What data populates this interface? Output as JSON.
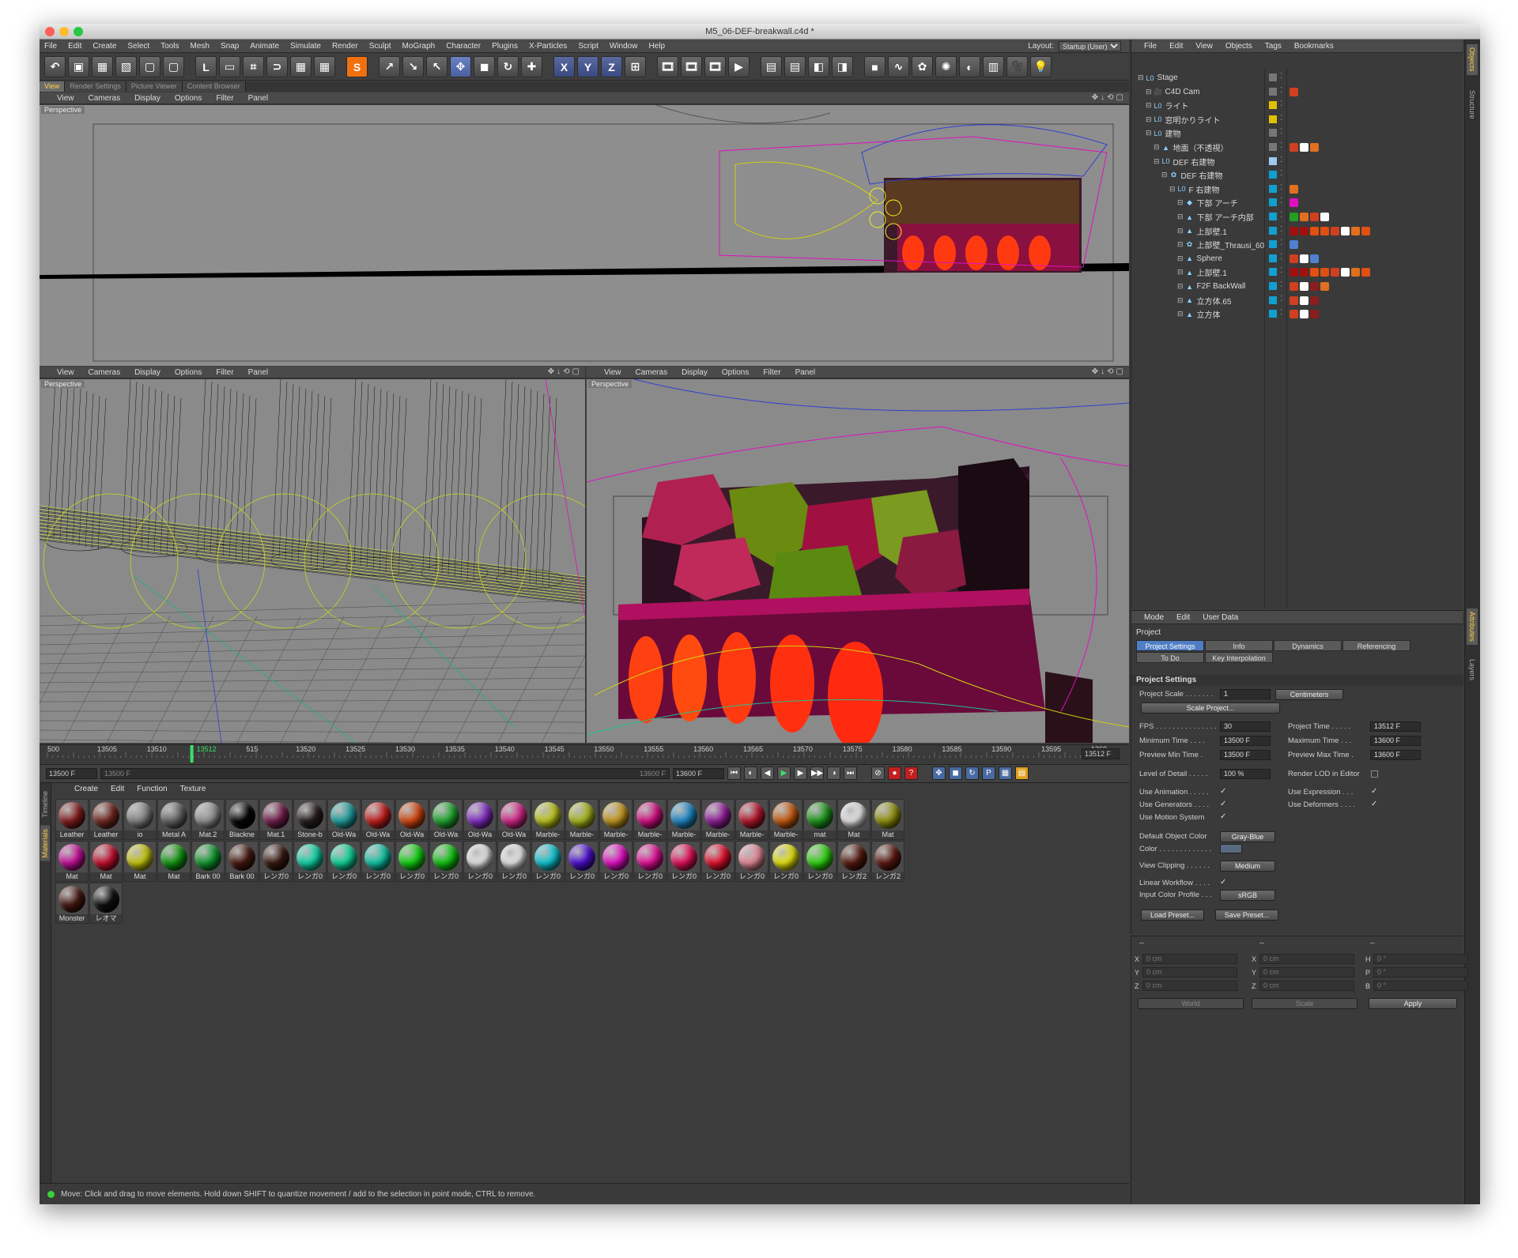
{
  "window": {
    "title": "M5_06-DEF-breakwall.c4d *",
    "traffic_colors": [
      "#ff5f57",
      "#febc2e",
      "#28c840"
    ]
  },
  "menubar": {
    "items": [
      "File",
      "Edit",
      "Create",
      "Select",
      "Tools",
      "Mesh",
      "Snap",
      "Animate",
      "Simulate",
      "Render",
      "Sculpt",
      "MoGraph",
      "Character",
      "Plugins",
      "X-Particles",
      "Script",
      "Window",
      "Help"
    ],
    "layout_label": "Layout:",
    "layout_value": "Startup (User)"
  },
  "toolbar": {
    "icons": [
      "undo-icon",
      "cube-view-icon",
      "checker-icon",
      "grid-icon",
      "box-icon",
      "box-icon",
      "axis-icon",
      "frame-icon",
      "crop-icon",
      "magnet-icon",
      "grid-snap-icon",
      "grid-snap-icon",
      "sculpt-s-icon",
      "arrow-icon",
      "arrow-icon",
      "select-icon",
      "move-icon",
      "scale-icon",
      "rotate-icon",
      "plus-icon",
      "x-axis-icon",
      "y-axis-icon",
      "z-axis-icon",
      "coords-icon",
      "film-icon",
      "film-icon",
      "film-icon",
      "play-icon",
      "render-icon",
      "render-icon",
      "render-icon",
      "render-icon",
      "cube-icon",
      "spline-icon",
      "nurbs-icon",
      "array-icon",
      "deformer-icon",
      "floor-icon",
      "camera-icon",
      "light-icon"
    ],
    "glyphs": [
      "↶",
      "▣",
      "▦",
      "▧",
      "▢",
      "▢",
      "L",
      "▭",
      "⌗",
      "⊃",
      "▦",
      "▦",
      "S",
      "↗",
      "↘",
      "↖",
      "✥",
      "◼",
      "↻",
      "✚",
      "X",
      "Y",
      "Z",
      "⊞",
      "🎞",
      "🎞",
      "🎞",
      "▶",
      "▤",
      "▤",
      "◧",
      "◨",
      "■",
      "∿",
      "✿",
      "✺",
      "◐",
      "▥",
      "🎥",
      "💡"
    ]
  },
  "tabs": [
    "View",
    "Render Settings",
    "Picture Viewer",
    "Content Browser"
  ],
  "viewport_menu": [
    "View",
    "Cameras",
    "Display",
    "Options",
    "Filter",
    "Panel"
  ],
  "viewport_label": "Perspective",
  "timeline": {
    "ticks": [
      "500",
      "13505",
      "13510",
      "13512",
      "515",
      "13520",
      "13525",
      "13530",
      "13535",
      "13540",
      "13545",
      "13550",
      "13555",
      "13560",
      "13565",
      "13570",
      "13575",
      "13580",
      "13585",
      "13590",
      "13595",
      "1360"
    ],
    "current_frame": "13512 F",
    "range_start": "13500 F",
    "range_field": "13500 F",
    "range_end_field": "13600 F",
    "end_frame": "13600 F"
  },
  "transport_glyphs": [
    "⏮",
    "◐",
    "◀",
    "▶",
    "▶",
    "▶▶",
    "◑",
    "⏭",
    "⊘",
    "●",
    "?",
    "✥",
    "◼",
    "↻",
    "P",
    "▦",
    "▤"
  ],
  "materials": {
    "menu": [
      "Create",
      "Edit",
      "Function",
      "Texture"
    ],
    "tabs": [
      "Timeline",
      "Materials"
    ],
    "items": [
      {
        "name": "Leather",
        "color": "#8a1e1e"
      },
      {
        "name": "Leather",
        "color": "#7a2a22"
      },
      {
        "name": "io",
        "color": "#8a8a8a"
      },
      {
        "name": "Metal A",
        "color": "#6a6a6a"
      },
      {
        "name": "Mat.2",
        "color": "#9a9a9a"
      },
      {
        "name": "Blackne",
        "color": "#050505"
      },
      {
        "name": "Mat.1",
        "color": "#7a2050"
      },
      {
        "name": "Stone-b",
        "color": "#2a2020"
      },
      {
        "name": "Old-Wa",
        "color": "#20a8a8"
      },
      {
        "name": "Old-Wa",
        "color": "#d02020"
      },
      {
        "name": "Old-Wa",
        "color": "#e04a10"
      },
      {
        "name": "Old-Wa",
        "color": "#20b030"
      },
      {
        "name": "Old-Wa",
        "color": "#8a30d0"
      },
      {
        "name": "Old-Wa",
        "color": "#e02a90"
      },
      {
        "name": "Marble-",
        "color": "#c8d020"
      },
      {
        "name": "Marble-",
        "color": "#b0c020"
      },
      {
        "name": "Marble-",
        "color": "#d0a020"
      },
      {
        "name": "Marble-",
        "color": "#e0108a"
      },
      {
        "name": "Marble-",
        "color": "#2090d0"
      },
      {
        "name": "Marble-",
        "color": "#9a20a0"
      },
      {
        "name": "Marble-",
        "color": "#c01830"
      },
      {
        "name": "Marble-",
        "color": "#d06010"
      },
      {
        "name": "mat",
        "color": "#1ea01e"
      },
      {
        "name": "Mat",
        "color": "#f0f0f0"
      },
      {
        "name": "Mat",
        "color": "#9a9a10"
      },
      {
        "name": "Mat",
        "color": "#d010a0"
      },
      {
        "name": "Mat",
        "color": "#d01030"
      },
      {
        "name": "Mat",
        "color": "#d0d010"
      },
      {
        "name": "Mat",
        "color": "#10a010"
      },
      {
        "name": "Bark 00",
        "color": "#10a030"
      },
      {
        "name": "Bark 00",
        "color": "#4a1a10"
      },
      {
        "name": "レンガ0",
        "color": "#3a1a10"
      },
      {
        "name": "レンガ0",
        "color": "#10e0b0"
      },
      {
        "name": "レンガ0",
        "color": "#10e0a0"
      },
      {
        "name": "レンガ0",
        "color": "#10d0b0"
      },
      {
        "name": "レンガ0",
        "color": "#10e010"
      },
      {
        "name": "レンガ0",
        "color": "#10d010"
      },
      {
        "name": "レンガ0",
        "color": "#f0f0f0"
      },
      {
        "name": "レンガ0",
        "color": "#f4f4f4"
      },
      {
        "name": "レンガ0",
        "color": "#10d0e0"
      },
      {
        "name": "レンガ0",
        "color": "#5010e0"
      },
      {
        "name": "レンガ0",
        "color": "#f010d0"
      },
      {
        "name": "レンガ0",
        "color": "#f010a0"
      },
      {
        "name": "レンガ0",
        "color": "#f01060"
      },
      {
        "name": "レンガ0",
        "color": "#f01030"
      },
      {
        "name": "レンガ0",
        "color": "#f090a0"
      },
      {
        "name": "レンガ0",
        "color": "#f0f010"
      },
      {
        "name": "レンガ0",
        "color": "#30e010"
      },
      {
        "name": "レンガ2",
        "color": "#5a1a10"
      },
      {
        "name": "レンガ2",
        "color": "#601a12"
      },
      {
        "name": "Monster",
        "color": "#4a1a14"
      },
      {
        "name": "レオマ",
        "color": "#101010"
      }
    ]
  },
  "status": {
    "text": "Move: Click and drag to move elements. Hold down SHIFT to quantize movement / add to the selection in point mode, CTRL to remove."
  },
  "objects": {
    "menu": [
      "File",
      "Edit",
      "View",
      "Objects",
      "Tags",
      "Bookmarks"
    ],
    "rows": [
      {
        "name": "Stage",
        "indent": 0,
        "icon": "layer-null-icon",
        "glyph": "L0",
        "layer": "#777777",
        "tags": []
      },
      {
        "name": "C4D Cam",
        "indent": 1,
        "icon": "camera-icon",
        "glyph": "🎥",
        "layer": "#777777",
        "tags": [
          "#d04020"
        ]
      },
      {
        "name": "ライト",
        "indent": 1,
        "icon": "layer-null-icon",
        "glyph": "L0",
        "layer": "#e0c000",
        "tags": []
      },
      {
        "name": "窓明かりライト",
        "indent": 1,
        "icon": "layer-null-icon",
        "glyph": "L0",
        "layer": "#e0c000",
        "tags": []
      },
      {
        "name": "建物",
        "indent": 1,
        "icon": "layer-null-icon",
        "glyph": "L0",
        "layer": "#777777",
        "tags": []
      },
      {
        "name": "地面（不透視）",
        "indent": 2,
        "icon": "polygon-icon",
        "glyph": "▲",
        "layer": "#777777",
        "tags": [
          "#d04020",
          "#ffffff",
          "#e07020"
        ]
      },
      {
        "name": "DEF 右建物",
        "indent": 2,
        "icon": "layer-null-icon",
        "glyph": "L0",
        "layer": "#a0c8f0",
        "tags": []
      },
      {
        "name": "DEF 右建物",
        "indent": 3,
        "icon": "fracture-icon",
        "glyph": "✿",
        "layer": "#10a0d0",
        "tags": []
      },
      {
        "name": "F 右建物",
        "indent": 4,
        "icon": "layer-null-icon",
        "glyph": "L0",
        "layer": "#10a0d0",
        "tags": [
          "#e07020"
        ]
      },
      {
        "name": "下部 アーチ",
        "indent": 5,
        "icon": "deformer-icon",
        "glyph": "◆",
        "layer": "#10a0d0",
        "tags": [
          "#e010c0"
        ]
      },
      {
        "name": "下部 アーチ内部",
        "indent": 5,
        "icon": "polygon-icon",
        "glyph": "▲",
        "layer": "#10a0d0",
        "tags": [
          "#20a020",
          "#e07020",
          "#d04020",
          "#ffffff"
        ]
      },
      {
        "name": "上部壁.1",
        "indent": 5,
        "icon": "polygon-icon",
        "glyph": "▲",
        "layer": "#10a0d0",
        "tags": [
          "#a01010",
          "#a01010",
          "#e05010",
          "#e05010",
          "#d04020",
          "#ffffff",
          "#e07020",
          "#e05010"
        ]
      },
      {
        "name": "上部壁_Thrausi_60",
        "indent": 5,
        "icon": "fracture-icon",
        "glyph": "✿",
        "layer": "#10a0d0",
        "tags": [
          "#5080d0"
        ]
      },
      {
        "name": "Sphere",
        "indent": 5,
        "icon": "polygon-icon",
        "glyph": "▲",
        "layer": "#10a0d0",
        "tags": [
          "#d04020",
          "#ffffff",
          "#5080d0"
        ]
      },
      {
        "name": "上部壁.1",
        "indent": 5,
        "icon": "polygon-icon",
        "glyph": "▲",
        "layer": "#10a0d0",
        "tags": [
          "#a01010",
          "#a01010",
          "#e05010",
          "#e05010",
          "#d04020",
          "#ffffff",
          "#e07020",
          "#e05010"
        ]
      },
      {
        "name": "F2F BackWall",
        "indent": 5,
        "icon": "polygon-icon",
        "glyph": "▲",
        "layer": "#10a0d0",
        "tags": [
          "#d04020",
          "#ffffff",
          "#8a1e1e",
          "#e07020"
        ]
      },
      {
        "name": "立方体.65",
        "indent": 5,
        "icon": "polygon-icon",
        "glyph": "▲",
        "layer": "#10a0d0",
        "tags": [
          "#d04020",
          "#ffffff",
          "#8a1e1e"
        ]
      },
      {
        "name": "立方体",
        "indent": 5,
        "icon": "polygon-icon",
        "glyph": "▲",
        "layer": "#10a0d0",
        "tags": [
          "#d04020",
          "#ffffff",
          "#8a1e1e"
        ]
      }
    ]
  },
  "attributes": {
    "menu": [
      "Mode",
      "Edit",
      "User Data"
    ],
    "header": "Project",
    "tabs": [
      "Project Settings",
      "Info",
      "Dynamics",
      "Referencing",
      "To Do",
      "Key Interpolation"
    ],
    "section": "Project Settings",
    "project_scale_label": "Project Scale . . . . . . .",
    "project_scale_value": "1",
    "project_scale_unit": "Centimeters",
    "scale_project_button": "Scale Project...",
    "fps_label": "FPS . . . . . . . . . . . . . . .",
    "fps_value": "30",
    "project_time_label": "Project Time . . . . .",
    "project_time_value": "13512 F",
    "min_time_label": "Minimum Time . . . .",
    "min_time_value": "13500 F",
    "max_time_label": "Maximum Time . . .",
    "max_time_value": "13600 F",
    "preview_min_label": "Preview Min Time .",
    "preview_min_value": "13500 F",
    "preview_max_label": "Preview Max Time .",
    "preview_max_value": "13600 F",
    "lod_label": "Level of Detail . . . . .",
    "lod_value": "100 %",
    "render_lod_label": "Render LOD in Editor",
    "use_animation_label": "Use Animation . . . . .",
    "use_expression_label": "Use Expression . . .",
    "use_generators_label": "Use Generators . . . .",
    "use_deformers_label": "Use Deformers . . . .",
    "use_motion_label": "Use Motion System",
    "default_color_label": "Default Object Color",
    "default_color_value": "Gray-Blue",
    "color_label": "Color . . . . . . . . . . . . .",
    "view_clipping_label": "View Clipping . . . . . .",
    "view_clipping_value": "Medium",
    "linear_workflow_label": "Linear Workflow . . . .",
    "input_profile_label": "Input Color Profile . . .",
    "input_profile_value": "sRGB",
    "load_preset": "Load Preset...",
    "save_preset": "Save Preset..."
  },
  "coordinates": {
    "headers": [
      "--",
      "--",
      "--"
    ],
    "rows": [
      {
        "a": "X",
        "av": "0 cm",
        "b": "X",
        "bv": "0 cm",
        "c": "H",
        "cv": "0 °"
      },
      {
        "a": "Y",
        "av": "0 cm",
        "b": "Y",
        "bv": "0 cm",
        "c": "P",
        "cv": "0 °"
      },
      {
        "a": "Z",
        "av": "0 cm",
        "b": "Z",
        "bv": "0 cm",
        "c": "B",
        "cv": "0 °"
      }
    ],
    "world": "World",
    "scale": "Scale",
    "apply": "Apply"
  },
  "side_tabs": [
    "Objects",
    "Structure",
    "Attributes",
    "Layers"
  ]
}
